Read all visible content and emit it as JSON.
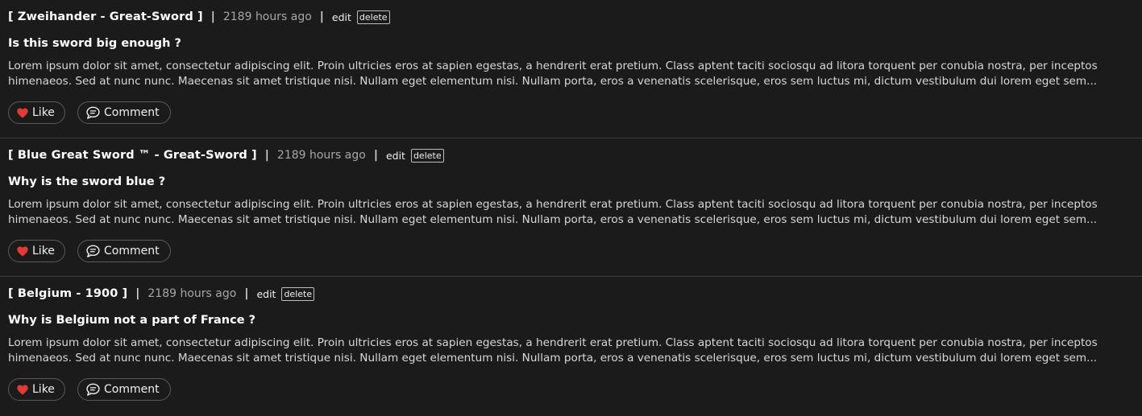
{
  "posts": [
    {
      "subject": "[ Zweihander - Great-Sword ]",
      "time": "2189 hours ago",
      "edit_label": "edit",
      "delete_label": "delete",
      "title": "Is this sword big enough ?",
      "body": "Lorem ipsum dolor sit amet, consectetur adipiscing elit. Proin ultricies eros at sapien egestas, a hendrerit erat pretium. Class aptent taciti sociosqu ad litora torquent per conubia nostra, per inceptos himenaeos. Sed at nunc nunc. Maecenas sit amet tristique nisi. Nullam eget elementum nisi. Nullam porta, eros a venenatis scelerisque, eros sem luctus mi, dictum vestibulum dui lorem eget sem...",
      "like_label": "Like",
      "comment_label": "Comment"
    },
    {
      "subject": "[ Blue Great Sword ™ - Great-Sword ]",
      "time": "2189 hours ago",
      "edit_label": "edit",
      "delete_label": "delete",
      "title": "Why is the sword blue ?",
      "body": "Lorem ipsum dolor sit amet, consectetur adipiscing elit. Proin ultricies eros at sapien egestas, a hendrerit erat pretium. Class aptent taciti sociosqu ad litora torquent per conubia nostra, per inceptos himenaeos. Sed at nunc nunc. Maecenas sit amet tristique nisi. Nullam eget elementum nisi. Nullam porta, eros a venenatis scelerisque, eros sem luctus mi, dictum vestibulum dui lorem eget sem...",
      "like_label": "Like",
      "comment_label": "Comment"
    },
    {
      "subject": "[ Belgium - 1900 ]",
      "time": "2189 hours ago",
      "edit_label": "edit",
      "delete_label": "delete",
      "title": "Why is Belgium not a part of France ?",
      "body": "Lorem ipsum dolor sit amet, consectetur adipiscing elit. Proin ultricies eros at sapien egestas, a hendrerit erat pretium. Class aptent taciti sociosqu ad litora torquent per conubia nostra, per inceptos himenaeos. Sed at nunc nunc. Maecenas sit amet tristique nisi. Nullam eget elementum nisi. Nullam porta, eros a venenatis scelerisque, eros sem luctus mi, dictum vestibulum dui lorem eget sem...",
      "like_label": "Like",
      "comment_label": "Comment"
    }
  ],
  "icons": {
    "like": "heart-icon",
    "comment": "comment-bubble-icon"
  },
  "colors": {
    "background": "#1b1b1b",
    "like_heart": "#e53935",
    "muted_text": "#a7a7a7"
  }
}
